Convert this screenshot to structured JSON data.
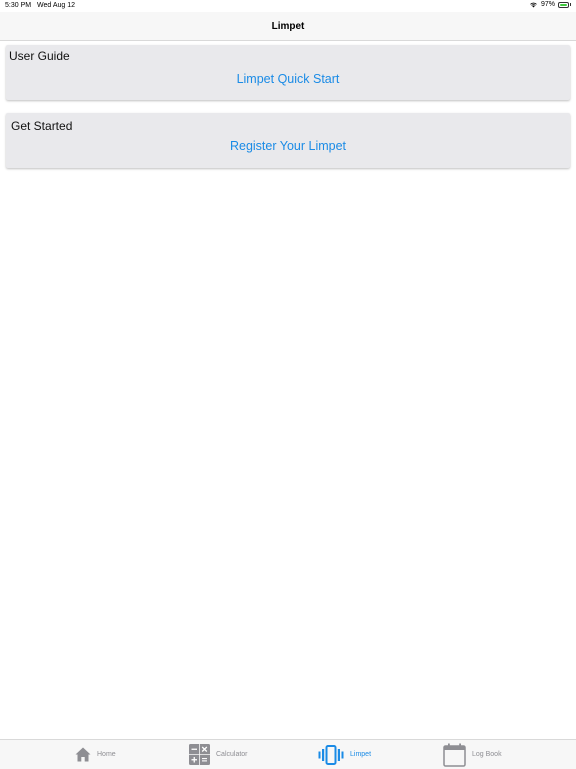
{
  "status_bar": {
    "time": "5:30 PM",
    "date": "Wed Aug 12",
    "battery": "97%",
    "icons": [
      "wifi-icon",
      "battery-icon"
    ]
  },
  "nav": {
    "title": "Limpet"
  },
  "sections": [
    {
      "heading": "User Guide",
      "link": "Limpet Quick Start"
    },
    {
      "heading": "Get Started",
      "link": "Register Your Limpet"
    }
  ],
  "tabs": [
    {
      "label": "Home",
      "icon": "home-icon",
      "active": false
    },
    {
      "label": "Calculator",
      "icon": "calculator-icon",
      "active": false
    },
    {
      "label": "Limpet",
      "icon": "vibration-icon",
      "active": true
    },
    {
      "label": "Log Book",
      "icon": "calendar-icon",
      "active": false
    }
  ],
  "colors": {
    "accent": "#1a8be6",
    "inactive_tab": "#8e8e93",
    "card_background": "#e9e9ec"
  }
}
